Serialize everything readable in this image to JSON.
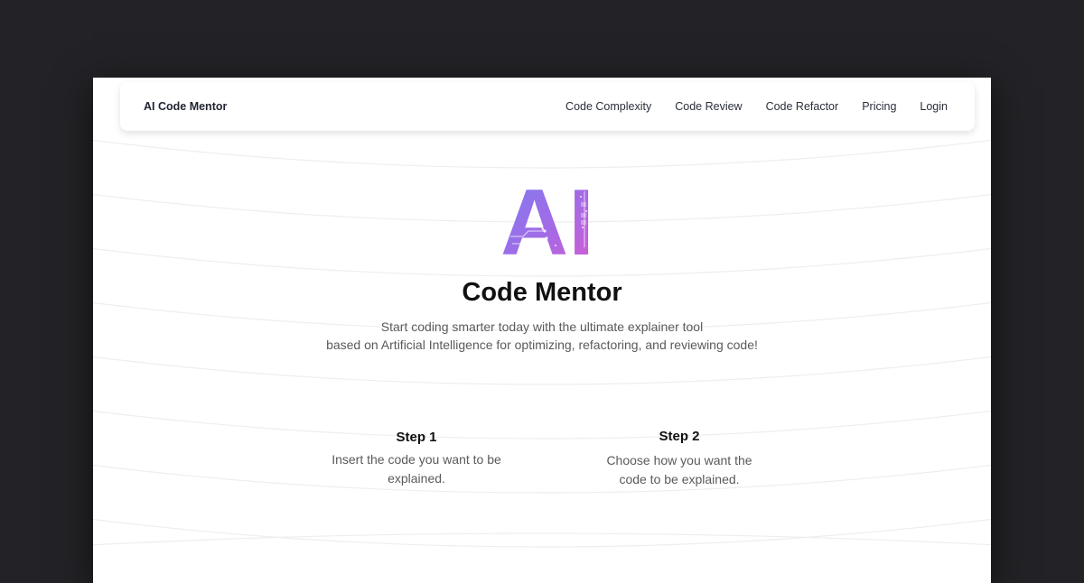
{
  "navbar": {
    "brand": "AI Code Mentor",
    "links": [
      {
        "label": "Code Complexity"
      },
      {
        "label": "Code Review"
      },
      {
        "label": "Code Refactor"
      },
      {
        "label": "Pricing"
      },
      {
        "label": "Login"
      }
    ]
  },
  "hero": {
    "logo_text": "AI",
    "title": "Code Mentor",
    "subtitle_line1": "Start coding smarter today with the ultimate explainer tool",
    "subtitle_line2": "based on Artificial Intelligence for optimizing, refactoring, and reviewing code!"
  },
  "steps": [
    {
      "title": "Step 1",
      "line1": "Insert the code you want to be",
      "line2": "explained."
    },
    {
      "title": "Step 2",
      "line1": "Choose how you want the",
      "line2": "code to be explained."
    }
  ],
  "colors": {
    "page_background": "#232226",
    "card_background": "#ffffff",
    "logo_gradient_start": "#7b7ef0",
    "logo_gradient_end": "#d85bd0"
  }
}
